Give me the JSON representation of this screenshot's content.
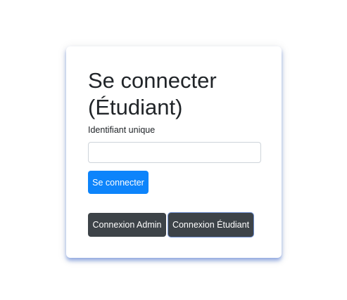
{
  "login": {
    "title_line1": "Se connecter",
    "title_line2": "(Étudiant)",
    "id_label": "Identifiant unique",
    "id_value": "",
    "id_placeholder": "",
    "submit_label": "Se connecter"
  },
  "switcher": {
    "admin_label": "Connexion Admin",
    "student_label": "Connexion Étudiant"
  },
  "colors": {
    "primary": "#0d84fb",
    "dark": "#3d4348",
    "text": "#212529"
  }
}
